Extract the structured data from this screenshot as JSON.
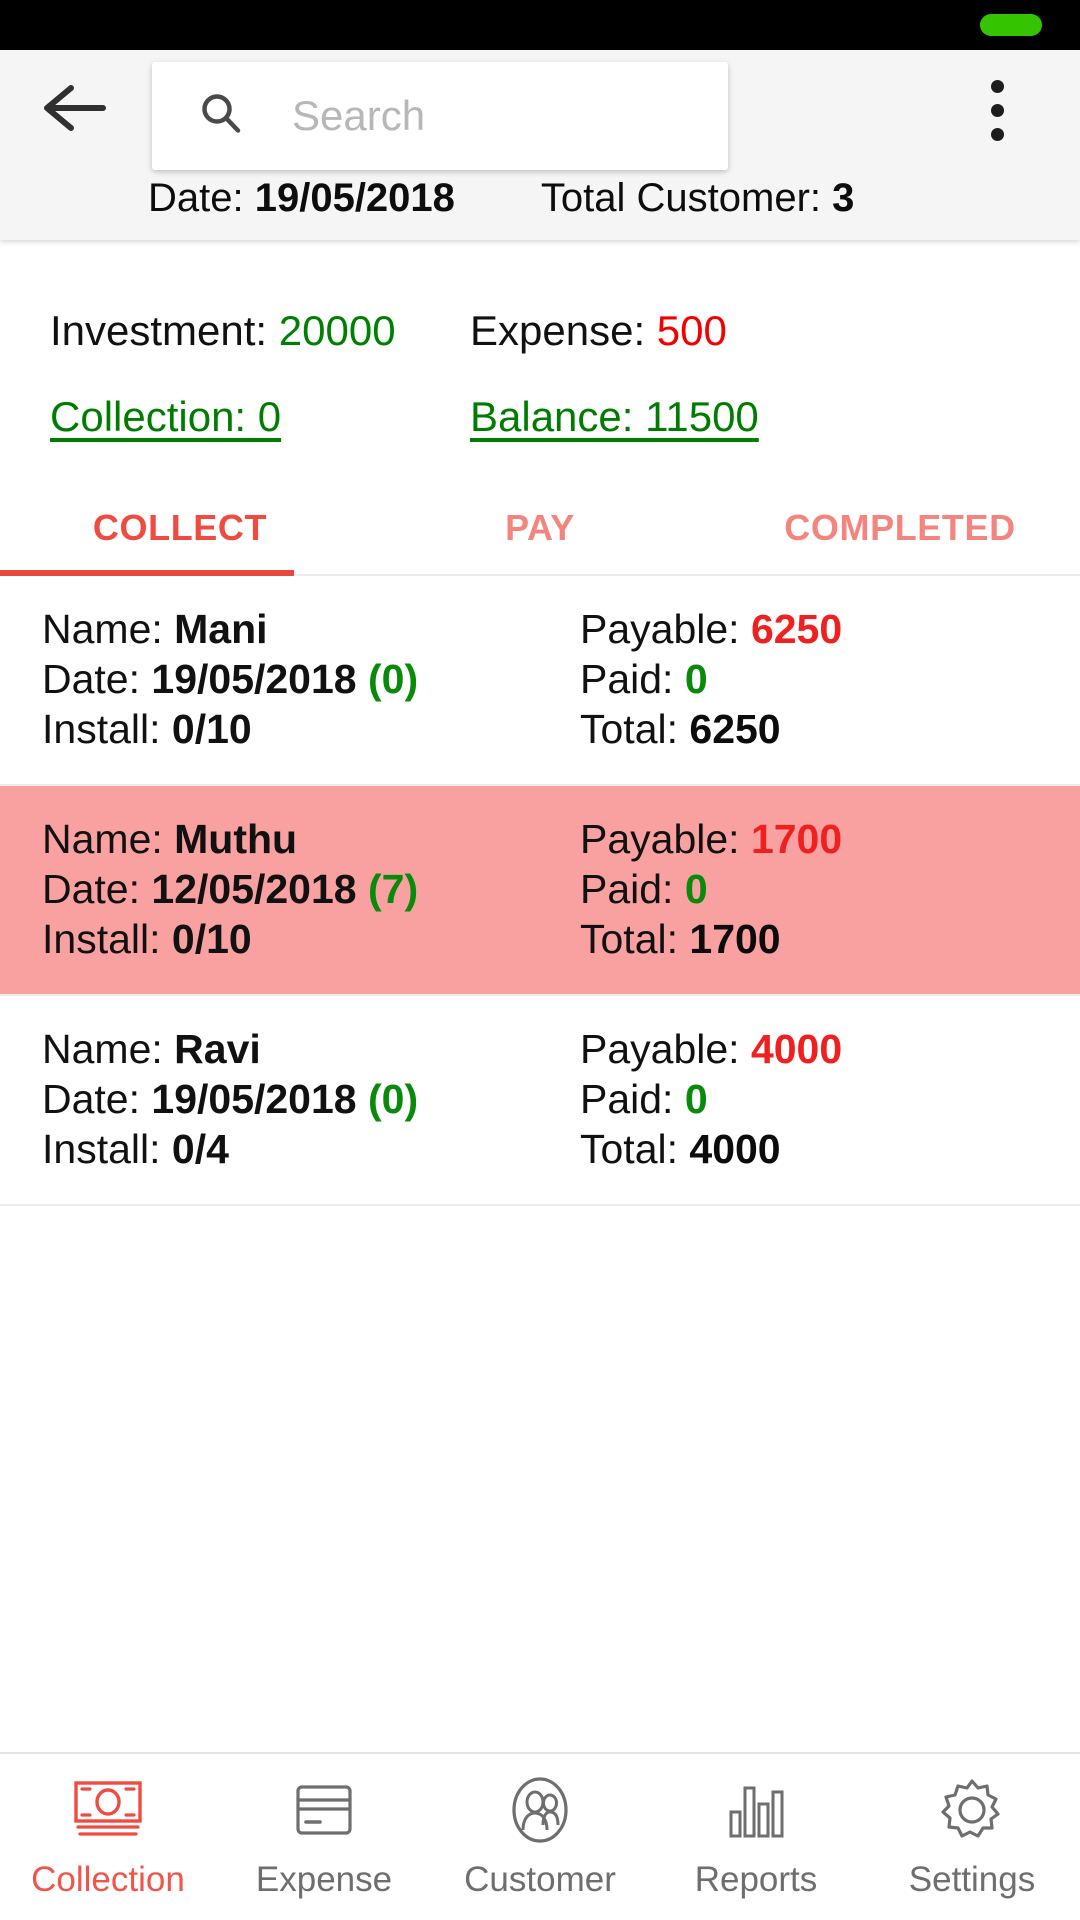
{
  "statusbar": {
    "battery_icon": "battery-pill"
  },
  "appbar": {
    "back_icon": "back-arrow-icon",
    "overflow_icon": "overflow-menu-icon",
    "search": {
      "icon": "search-icon",
      "placeholder": "Search",
      "value": ""
    },
    "date_label": "Date: ",
    "date_value": "19/05/2018",
    "total_customer_label": "Total Customer: ",
    "total_customer_value": "3"
  },
  "summary": {
    "investment_label": "Investment: ",
    "investment_value": "20000",
    "expense_label": "Expense: ",
    "expense_value": "500",
    "collection_link": "Collection: 0",
    "balance_link": "Balance: 11500"
  },
  "tabs": [
    {
      "label": "COLLECT",
      "active": true
    },
    {
      "label": "PAY",
      "active": false
    },
    {
      "label": "COMPLETED",
      "active": false
    }
  ],
  "list": {
    "labels": {
      "name": "Name: ",
      "date": "Date: ",
      "install": "Install: ",
      "payable": "Payable: ",
      "paid": "Paid: ",
      "total": "Total: "
    },
    "rows": [
      {
        "name": "Mani",
        "date": "19/05/2018",
        "days": "(0)",
        "install": "0/10",
        "payable": "6250",
        "paid": "0",
        "total": "6250",
        "highlighted": false
      },
      {
        "name": "Muthu",
        "date": "12/05/2018",
        "days": "(7)",
        "install": "0/10",
        "payable": "1700",
        "paid": "0",
        "total": "1700",
        "highlighted": true
      },
      {
        "name": "Ravi",
        "date": "19/05/2018",
        "days": "(0)",
        "install": "0/4",
        "payable": "4000",
        "paid": "0",
        "total": "4000",
        "highlighted": false
      }
    ]
  },
  "bottomnav": [
    {
      "label": "Collection",
      "icon": "banknote-icon",
      "active": true
    },
    {
      "label": "Expense",
      "icon": "credit-card-icon",
      "active": false
    },
    {
      "label": "Customer",
      "icon": "people-circle-icon",
      "active": false
    },
    {
      "label": "Reports",
      "icon": "bar-chart-icon",
      "active": false
    },
    {
      "label": "Settings",
      "icon": "gear-icon",
      "active": false
    }
  ],
  "colors": {
    "accent_red": "#ef4b41",
    "accent_red_faded": "#f4857e",
    "green": "#008000",
    "red_value": "#f40000",
    "highlight_row": "#f9a0a0",
    "status_bar": "#000000",
    "battery_green": "#35c500",
    "appbar_bg": "#f5f5f5"
  }
}
